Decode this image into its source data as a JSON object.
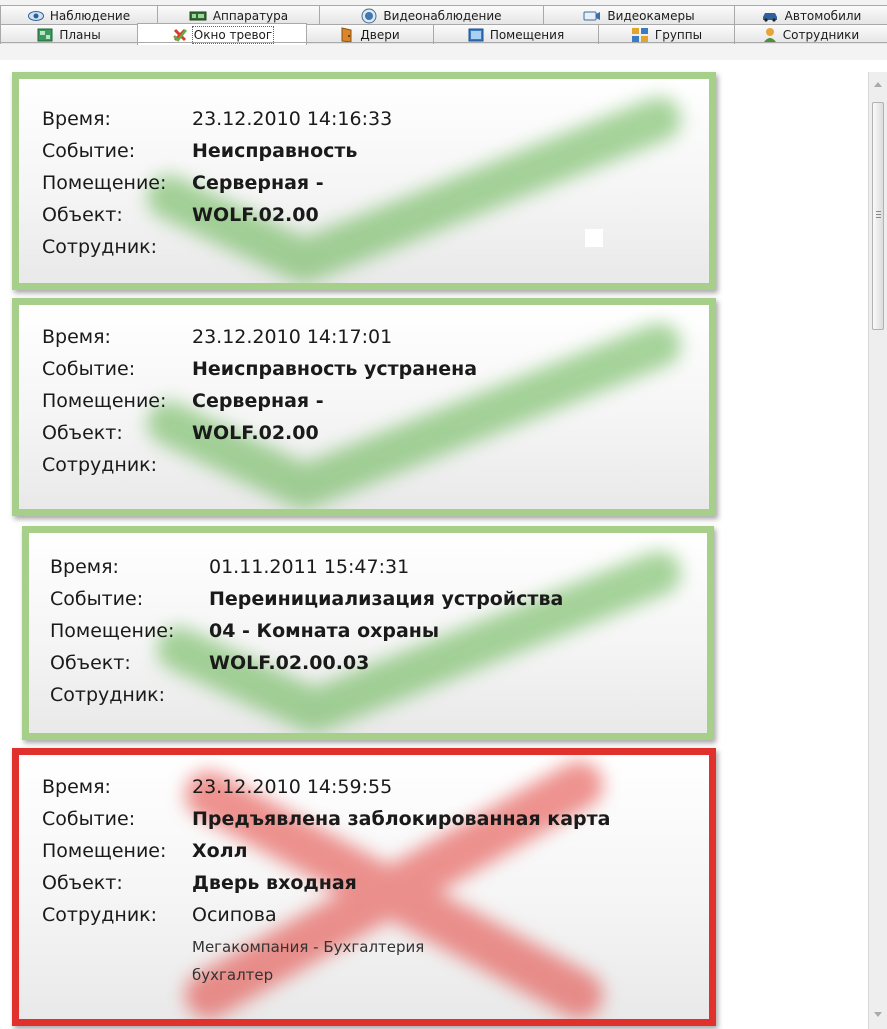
{
  "tabs_row1": [
    {
      "label": "Наблюдение",
      "icon": "eye-icon"
    },
    {
      "label": "Аппаратура",
      "icon": "hardware-icon"
    },
    {
      "label": "Видеонаблюдение",
      "icon": "video-surveillance-icon"
    },
    {
      "label": "Видеокамеры",
      "icon": "camera-icon"
    },
    {
      "label": "Автомобили",
      "icon": "car-icon"
    }
  ],
  "tabs_row2": [
    {
      "label": "Планы",
      "icon": "plan-icon"
    },
    {
      "label": "Окно тревог",
      "icon": "alarm-icon",
      "active": true
    },
    {
      "label": "Двери",
      "icon": "door-icon"
    },
    {
      "label": "Помещения",
      "icon": "rooms-icon"
    },
    {
      "label": "Группы",
      "icon": "groups-icon"
    },
    {
      "label": "Сотрудники",
      "icon": "employee-icon"
    }
  ],
  "labels": {
    "time": "Время:",
    "event": "Событие:",
    "room": "Помещение:",
    "object": "Объект:",
    "employee": "Сотрудник:"
  },
  "alarms": [
    {
      "status": "ok",
      "time": "23.12.2010 14:16:33",
      "event": "Неисправность",
      "room": "Серверная -",
      "object": "WOLF.02.00",
      "employee": "",
      "employee_department": "",
      "employee_position": ""
    },
    {
      "status": "ok",
      "time": "23.12.2010 14:17:01",
      "event": "Неисправность устранена",
      "room": "Серверная -",
      "object": "WOLF.02.00",
      "employee": "",
      "employee_department": "",
      "employee_position": ""
    },
    {
      "status": "ok",
      "time": "01.11.2011 15:47:31",
      "event": "Переинициализация устройства",
      "room": "04 - Комната охраны",
      "object": "WOLF.02.00.03",
      "employee": "",
      "employee_department": "",
      "employee_position": ""
    },
    {
      "status": "alarm",
      "time": "23.12.2010 14:59:55",
      "event": "Предъявлена заблокированная карта",
      "room": "Холл",
      "object": "Дверь входная",
      "employee": "Осипова",
      "employee_department": "Мегакомпания - Бухгалтерия",
      "employee_position": "бухгалтер"
    }
  ],
  "colors": {
    "ok_border": "#a6cf8a",
    "alarm_border": "#e0312d",
    "check_mark": "#5fb24a",
    "cross_mark": "#e23c36"
  }
}
